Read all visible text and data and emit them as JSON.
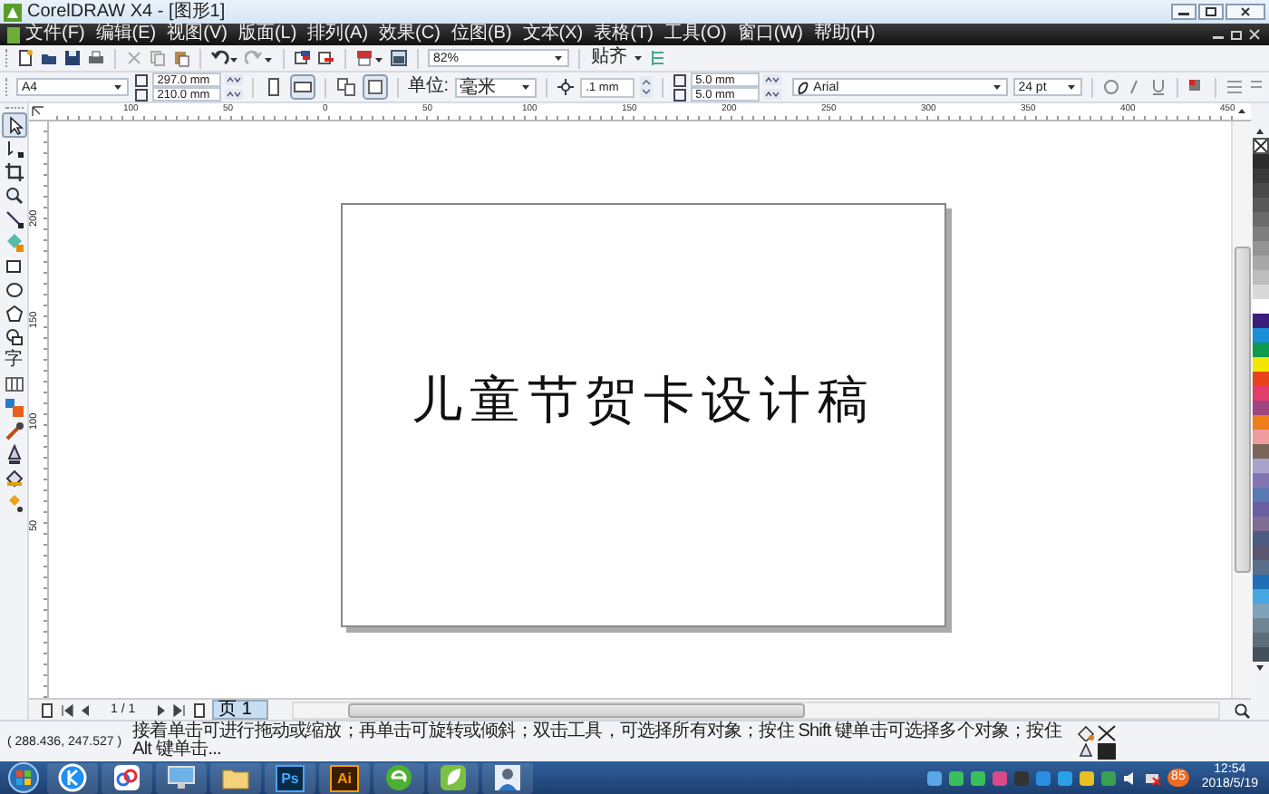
{
  "window": {
    "title": "CorelDRAW X4 - [图形1]"
  },
  "menu": [
    "文件(F)",
    "编辑(E)",
    "视图(V)",
    "版面(L)",
    "排列(A)",
    "效果(C)",
    "位图(B)",
    "文本(X)",
    "表格(T)",
    "工具(O)",
    "窗口(W)",
    "帮助(H)"
  ],
  "standard_toolbar": {
    "zoom": "82%",
    "snap": "贴齐"
  },
  "property_bar": {
    "paper": "A4",
    "width": "297.0 mm",
    "height": "210.0 mm",
    "units_label": "单位:",
    "units": "毫米",
    "nudge": ".1 mm",
    "duplicate_x": "5.0 mm",
    "duplicate_y": "5.0 mm",
    "font": "Arial",
    "font_size": "24 pt"
  },
  "toolbox": [
    {
      "kind": "pointer",
      "selected": true
    },
    {
      "kind": "shape",
      "selected": false
    },
    {
      "kind": "crop",
      "selected": false
    },
    {
      "kind": "zoom",
      "selected": false
    },
    {
      "kind": "freehand",
      "selected": false
    },
    {
      "kind": "smartfill",
      "selected": false
    },
    {
      "kind": "rectangle",
      "selected": false
    },
    {
      "kind": "ellipse",
      "selected": false
    },
    {
      "kind": "polygon",
      "selected": false
    },
    {
      "kind": "shapes",
      "selected": false
    },
    {
      "kind": "text",
      "label": "字",
      "selected": false
    },
    {
      "kind": "table",
      "selected": false
    },
    {
      "kind": "blend",
      "selected": false
    },
    {
      "kind": "eyedropper",
      "selected": false
    },
    {
      "kind": "outline",
      "selected": false
    },
    {
      "kind": "fill",
      "selected": false
    },
    {
      "kind": "meshfill",
      "selected": false
    }
  ],
  "rulers": {
    "horizontal": [
      "100",
      "50",
      "0",
      "50",
      "100",
      "150",
      "200",
      "250",
      "300",
      "350",
      "400",
      "450"
    ],
    "vertical": [
      "200",
      "150",
      "100",
      "50"
    ]
  },
  "page": {
    "text": "儿童节贺卡设计稿"
  },
  "palette": [
    {
      "color": "#2b2b2b"
    },
    {
      "color": "#3a3a3a"
    },
    {
      "color": "#4a4a4a"
    },
    {
      "color": "#595959"
    },
    {
      "color": "#6b6b6b"
    },
    {
      "color": "#7f7f7f"
    },
    {
      "color": "#939393"
    },
    {
      "color": "#a8a8a8"
    },
    {
      "color": "#bdbdbd"
    },
    {
      "color": "#d9d9d9"
    },
    {
      "color": "#ffffff"
    },
    {
      "color": "#3a1f7d"
    },
    {
      "color": "#1a8ed8"
    },
    {
      "color": "#0d9a4a"
    },
    {
      "color": "#f2e600"
    },
    {
      "color": "#e8431a"
    },
    {
      "color": "#e33d6b"
    },
    {
      "color": "#a0457f"
    },
    {
      "color": "#ef7d1a"
    },
    {
      "color": "#f09c9c"
    },
    {
      "color": "#7a6659"
    },
    {
      "color": "#a9a3cc"
    },
    {
      "color": "#8375b3"
    },
    {
      "color": "#5a7ab5"
    },
    {
      "color": "#6b5fa3"
    },
    {
      "color": "#7f6d94"
    },
    {
      "color": "#4d5b82"
    },
    {
      "color": "#5b5770"
    },
    {
      "color": "#5a6f8a"
    },
    {
      "color": "#1f6fb8"
    },
    {
      "color": "#46a6e0"
    },
    {
      "color": "#7fa3bb"
    },
    {
      "color": "#6f8593"
    },
    {
      "color": "#5d6e78"
    },
    {
      "color": "#44515a"
    }
  ],
  "page_nav": {
    "count": "1 / 1",
    "tabs": [
      {
        "label": "页 1",
        "selected": true
      }
    ]
  },
  "status_bar": {
    "coordinates": "( 288.436, 247.527 )",
    "hint": "接着单击可进行拖动或缩放；再单击可旋转或倾斜；双击工具，可选择所有对象；按住 Shift 键单击可选择多个对象；按住 Alt 键单击..."
  },
  "taskbar": {
    "apps": [
      {
        "kind": "start"
      },
      {
        "kind": "k-app"
      },
      {
        "kind": "cloud"
      },
      {
        "kind": "monitor"
      },
      {
        "kind": "folder"
      },
      {
        "kind": "ps",
        "label": "Ps"
      },
      {
        "kind": "ai",
        "label": "Ai"
      },
      {
        "kind": "browser"
      },
      {
        "kind": "leaf"
      },
      {
        "kind": "person"
      }
    ],
    "tray_badge": "85",
    "time": "12:54",
    "date": "2018/5/19"
  }
}
